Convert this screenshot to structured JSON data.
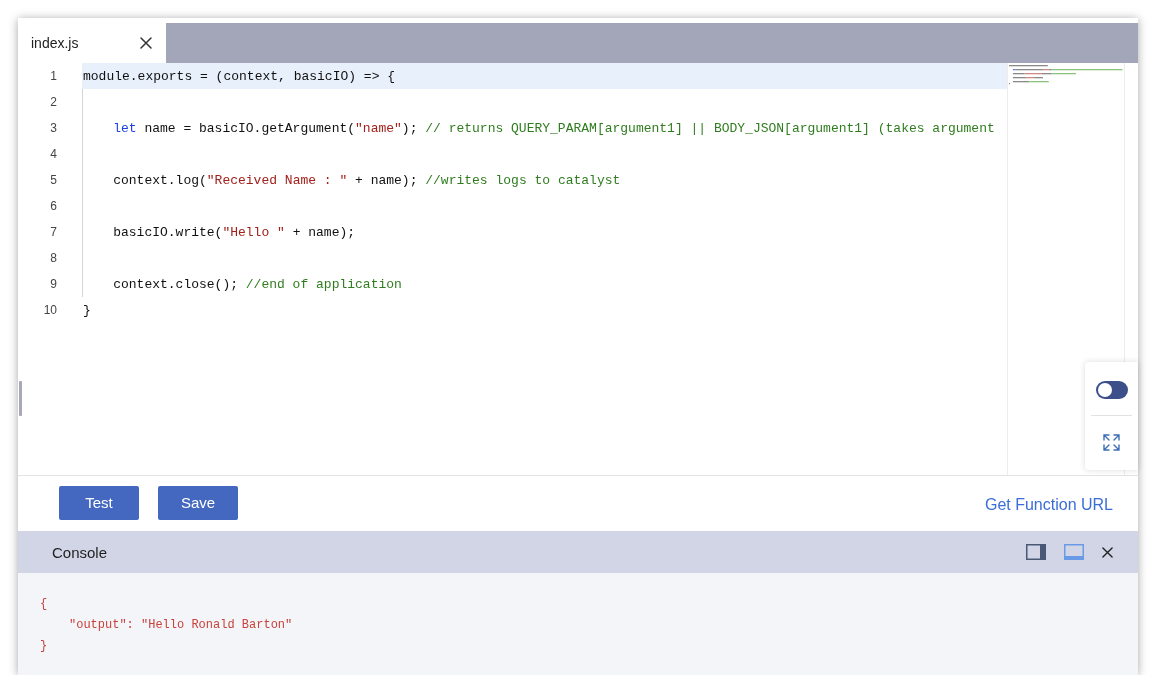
{
  "tabs": [
    {
      "label": "index.js",
      "selected": true
    }
  ],
  "editor": {
    "lines": [
      {
        "number": "1",
        "highlighted": true,
        "tokens": [
          {
            "kind": "plain",
            "text": "module.exports = (context, basicIO) => {"
          }
        ],
        "children": [
          {
            "number": "2",
            "highlighted": false
          },
          {
            "number": "3",
            "highlighted": false,
            "tokens": [
              {
                "kind": "keyword",
                "text": "let"
              },
              {
                "kind": "plain",
                "text": " name = basicIO.getArgument("
              },
              {
                "kind": "string",
                "text": "\"name\""
              },
              {
                "kind": "plain",
                "text": "); "
              },
              {
                "kind": "comment",
                "text": "// returns QUERY_PARAM[argument1] || BODY_JSON[argument1] (takes argument"
              }
            ]
          },
          {
            "number": "4",
            "highlighted": false
          },
          {
            "number": "5",
            "highlighted": false,
            "tokens": [
              {
                "kind": "plain",
                "text": "context.log("
              },
              {
                "kind": "string",
                "text": "\"Received Name : \""
              },
              {
                "kind": "plain",
                "text": " + name); "
              },
              {
                "kind": "comment",
                "text": "//writes logs to catalyst"
              }
            ]
          },
          {
            "number": "6",
            "highlighted": false
          },
          {
            "number": "7",
            "highlighted": false,
            "tokens": [
              {
                "kind": "plain",
                "text": "basicIO.write("
              },
              {
                "kind": "string",
                "text": "\"Hello \""
              },
              {
                "kind": "plain",
                "text": " + name);"
              }
            ]
          },
          {
            "number": "8",
            "highlighted": false
          },
          {
            "number": "9",
            "highlighted": false,
            "tokens": [
              {
                "kind": "plain",
                "text": "context.close(); "
              },
              {
                "kind": "comment",
                "text": "//end of application"
              }
            ]
          }
        ]
      },
      {
        "number": "10",
        "highlighted": false,
        "tokens": [
          {
            "kind": "plain",
            "text": "}"
          }
        ]
      }
    ]
  },
  "side_panel": {
    "toggle": {
      "on": false
    }
  },
  "toolbar": {
    "buttons": [
      "Test",
      "Save"
    ],
    "link": "Get Function URL"
  },
  "console": {
    "title": "Console",
    "layouts": [
      {
        "kind": "side",
        "selected": false
      },
      {
        "kind": "bottom",
        "selected": true
      }
    ],
    "lines": [
      {
        "text": "{",
        "children": [
          {
            "text": "\"output\": \"Hello Ronald Barton\""
          }
        ]
      },
      {
        "text": "}"
      }
    ]
  }
}
